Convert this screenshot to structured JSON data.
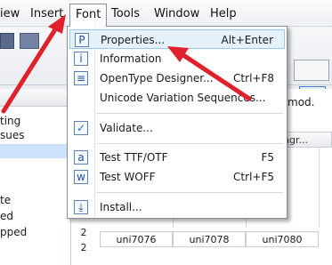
{
  "menubar": {
    "items": [
      {
        "label": "iew"
      },
      {
        "label": "Insert"
      },
      {
        "label": "Font"
      },
      {
        "label": "Tools"
      },
      {
        "label": "Window"
      },
      {
        "label": "Help"
      }
    ]
  },
  "font_menu": {
    "items": [
      {
        "label": "Properties...",
        "shortcut": "Alt+Enter",
        "icon": "properties-icon"
      },
      {
        "label": "Information",
        "shortcut": "",
        "icon": "information-icon"
      },
      {
        "label": "OpenType Designer...",
        "shortcut": "Ctrl+F8",
        "icon": "opentype-designer-icon"
      },
      {
        "label": "Unicode Variation Sequences...",
        "shortcut": "",
        "icon": ""
      },
      {
        "label": "Validate...",
        "shortcut": "",
        "icon": "validate-check-icon"
      },
      {
        "label": "Test TTF/OTF",
        "shortcut": "F5",
        "icon": "test-ttf-icon"
      },
      {
        "label": "Test WOFF",
        "shortcut": "Ctrl+F5",
        "icon": "test-woff-icon"
      },
      {
        "label": "Install...",
        "shortcut": "",
        "icon": "install-icon"
      }
    ]
  },
  "left_panel": {
    "rows": [
      "ting",
      "sues",
      "",
      "te",
      "ed",
      "pped"
    ]
  },
  "grid": {
    "tab_title": "体_mod.",
    "col_header_partial": "ingr...",
    "row_numbers": [
      "2",
      "2"
    ],
    "cells": [
      "uni7076",
      "uni7078",
      "uni7080"
    ]
  },
  "colors": {
    "arrow": "#e0202a",
    "highlight": "#e5f1fb"
  }
}
